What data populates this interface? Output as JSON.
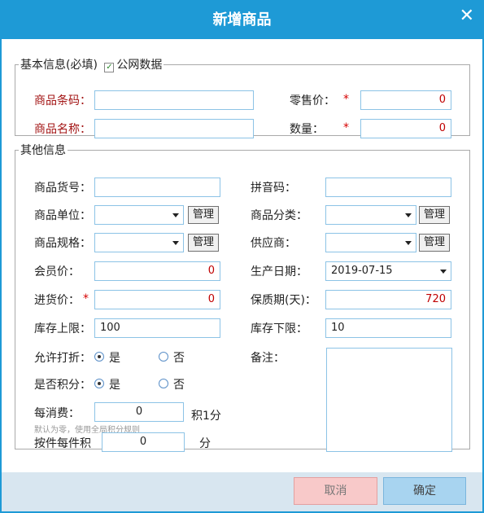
{
  "window": {
    "title": "新增商品",
    "close_glyph": "✕"
  },
  "basic": {
    "legend": "基本信息(必填)",
    "public_data_label": "公网数据",
    "public_data_checked": true,
    "barcode_label": "商品条码：",
    "barcode_value": "",
    "name_label": "商品名称：",
    "name_value": "",
    "retail_label": "零售价：",
    "retail_value": "0",
    "qty_label": "数量：",
    "qty_value": "0",
    "required_mark": "*"
  },
  "other": {
    "legend": "其他信息",
    "sku_label": "商品货号：",
    "sku_value": "",
    "pinyin_label": "拼音码：",
    "pinyin_value": "",
    "unit_label": "商品单位：",
    "unit_value": "",
    "manage_label": "管理",
    "category_label": "商品分类：",
    "category_value": "",
    "spec_label": "商品规格：",
    "spec_value": "",
    "supplier_label": "供应商：",
    "supplier_value": "",
    "member_price_label": "会员价：",
    "member_price_value": "0",
    "prod_date_label": "生产日期：",
    "prod_date_value": "2019-07-15",
    "purchase_price_label": "进货价：",
    "purchase_price_value": "0",
    "required_mark": "*",
    "shelf_life_label": "保质期(天)：",
    "shelf_life_value": "720",
    "stock_max_label": "库存上限：",
    "stock_max_value": "100",
    "stock_min_label": "库存下限：",
    "stock_min_value": "10",
    "discount_label": "允许打折：",
    "discount_yes": "是",
    "discount_no": "否",
    "discount_selected": "是",
    "points_label": "是否积分：",
    "points_yes": "是",
    "points_no": "否",
    "points_selected": "是",
    "remark_label": "备注：",
    "remark_value": "",
    "per_spend_label": "每消费：",
    "per_spend_value": "0",
    "per_spend_unit": "积1分",
    "per_spend_hint": "默认为零，使用全局积分规则",
    "per_item_label": "按件每件积",
    "per_item_value": "0",
    "per_item_unit": "分"
  },
  "footer": {
    "cancel_label": "取消",
    "ok_label": "确定"
  },
  "colors": {
    "titlebar": "#1e9ad6",
    "label_red": "#a31515",
    "value_red": "#c00000",
    "input_border": "#8cc3e6"
  }
}
